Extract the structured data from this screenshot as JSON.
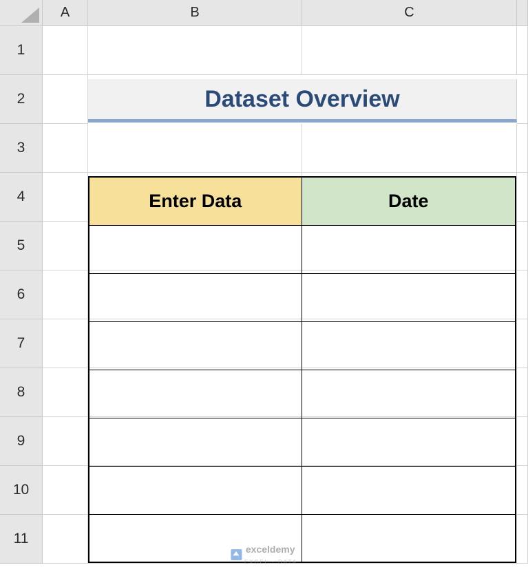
{
  "columns": [
    "A",
    "B",
    "C"
  ],
  "rows": [
    "1",
    "2",
    "3",
    "4",
    "5",
    "6",
    "7",
    "8",
    "9",
    "10",
    "11"
  ],
  "title": "Dataset Overview",
  "table": {
    "headers": {
      "enter_data": "Enter Data",
      "date": "Date"
    },
    "data_rows": [
      {
        "enter": "",
        "date": ""
      },
      {
        "enter": "",
        "date": ""
      },
      {
        "enter": "",
        "date": ""
      },
      {
        "enter": "",
        "date": ""
      },
      {
        "enter": "",
        "date": ""
      },
      {
        "enter": "",
        "date": ""
      },
      {
        "enter": "",
        "date": ""
      }
    ]
  },
  "watermark": {
    "brand": "exceldemy",
    "sub": "EXCEL · DATA"
  }
}
